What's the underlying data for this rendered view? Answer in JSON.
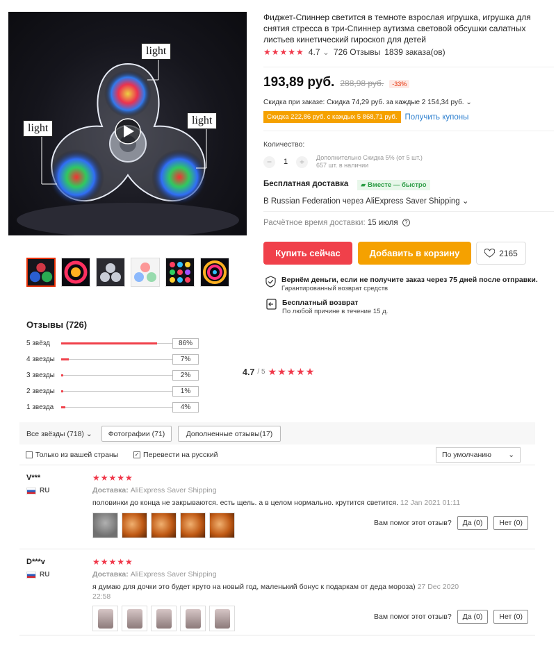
{
  "gallery": {
    "callouts": [
      "light",
      "light",
      "light"
    ]
  },
  "product": {
    "title": "Фиджет-Спиннер светится в темноте взрослая игрушка, игрушка для снятия стресса в три-Спиннер аутизма световой обсушки салатных листьев кинетический гироскоп для детей",
    "rating_stars": "★★★★★",
    "rating": "4.7",
    "rating_chevron": "⌄",
    "reviews_count": "726 Отзывы",
    "orders_count": "1839 заказа(ов)",
    "price": "193,89 руб.",
    "old_price": "288,98 руб.",
    "discount": "-33%",
    "order_discount": "Скидка при заказе: Скидка 74,29 руб. за каждые 2 154,34 руб. ⌄",
    "coupon_badge": "Скидка 222,86 руб. с каждых 5 868,71 руб.",
    "coupon_link": "Получить купоны"
  },
  "quantity": {
    "label": "Количество:",
    "minus": "−",
    "value": "1",
    "plus": "+",
    "note_line1": "Дополнительно Скидка 5% (от 5 шт.)",
    "note_line2": "657 шт. в наличии"
  },
  "shipping": {
    "title": "Бесплатная доставка",
    "badge": "Вместе — быстро",
    "destination": "В Russian Federation через AliExpress Saver Shipping ⌄",
    "estimate_label": "Расчётное время доставки:",
    "estimate_date": "15 июля",
    "help_glyph": "?"
  },
  "actions": {
    "buy": "Купить сейчас",
    "cart": "Добавить в корзину",
    "wishlist_count": "2165"
  },
  "guarantees": [
    {
      "title": "Вернём деньги, если не получите заказ через 75 дней после отправки.",
      "subtitle": "Гарантированный возврат средств"
    },
    {
      "title": "Бесплатный возврат",
      "subtitle": "По любой причине в течение 15 д."
    }
  ],
  "reviews_summary": {
    "title": "Отзывы (726)",
    "rows": [
      {
        "label": "5 звёзд",
        "pct": "86%",
        "value": 86
      },
      {
        "label": "4 звезды",
        "pct": "7%",
        "value": 7
      },
      {
        "label": "3 звезды",
        "pct": "2%",
        "value": 2
      },
      {
        "label": "2 звезды",
        "pct": "1%",
        "value": 1
      },
      {
        "label": "1 звезда",
        "pct": "4%",
        "value": 4
      }
    ],
    "average": "4.7",
    "average_of": "/ 5",
    "stars": "★★★★★"
  },
  "filters": {
    "all_stars": "Все звёзды (718)",
    "chevron": "⌄",
    "photos": "Фотографии (71)",
    "additional": "Дополненные отзывы(17)",
    "only_country": "Только из вашей страны",
    "translate": "Перевести на русский",
    "check_mark": "✓",
    "sort": "По умолчанию"
  },
  "reviews": [
    {
      "user": "V***",
      "country": "RU",
      "stars": "★★★★★",
      "shipping_label": "Доставка:",
      "shipping_value": "AliExpress Saver Shipping",
      "text": "половинки до конца не закрываются. есть щель. а в целом нормально. крутится светится.",
      "date": "12 Jan 2021 01:11",
      "helpful_q": "Вам помог этот отзыв?",
      "yes": "Да (0)",
      "no": "Нет (0)"
    },
    {
      "user": "D***v",
      "country": "RU",
      "stars": "★★★★★",
      "shipping_label": "Доставка:",
      "shipping_value": "AliExpress Saver Shipping",
      "text": "я думаю для дочки это будет круто на новый год, маленький бонус к подаркам от деда мороза)",
      "date": "27 Dec 2020 22:58",
      "helpful_q": "Вам помог этот отзыв?",
      "yes": "Да (0)",
      "no": "Нет (0)"
    }
  ]
}
